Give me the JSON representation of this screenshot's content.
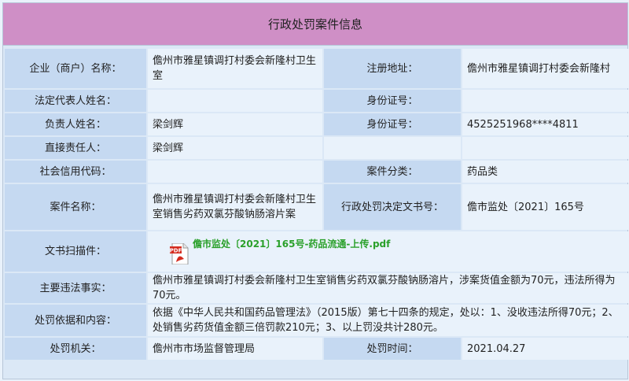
{
  "header": {
    "title": "行政处罚案件信息"
  },
  "rows": {
    "company_label": "企业（商户）名称：",
    "company_value": "儋州市雅星镇调打村委会新隆村卫生室",
    "reg_address_label": "注册地址：",
    "reg_address_value": "儋州市雅星镇调打村委会新隆村",
    "legal_rep_label": "法定代表人姓名：",
    "legal_rep_value": "",
    "id1_label": "身份证号：",
    "id1_value": "",
    "principal_label": "负责人姓名：",
    "principal_value": "梁剑辉",
    "id2_label": "身份证号：",
    "id2_value": "4525251968****4811",
    "direct_label": "直接责任人：",
    "direct_value": "梁剑辉",
    "credit_label": "社会信用代码：",
    "credit_value": "",
    "category_label": "案件分类：",
    "category_value": "药品类",
    "case_name_label": "案件名称：",
    "case_name_value": "儋州市雅星镇调打村委会新隆村卫生室销售劣药双氯芬酸钠肠溶片案",
    "decision_no_label": "行政处罚决定文书号：",
    "decision_no_value": "儋市监处〔2021〕165号",
    "scan_label": "文书扫描件：",
    "scan_file": "儋市监处〔2021〕165号-药品流通-上传.pdf",
    "facts_label": "主要违法事实：",
    "facts_value": "儋州市雅星镇调打村委会新隆村卫生室销售劣药双氯芬酸钠肠溶片，涉案货值金额为70元，违法所得为70元。",
    "basis_label": "处罚依据和内容：",
    "basis_value": "依据《中华人民共和国药品管理法》（2015版）第七十四条的规定，处以：1、没收违法所得70元；2、处销售劣药货值金额三倍罚款210元；3、以上罚没共计280元。",
    "authority_label": "处罚机关：",
    "authority_value": "儋州市市场监督管理局",
    "time_label": "处罚时间：",
    "time_value": "2021.04.27"
  },
  "icons": {
    "file": "pdf-icon"
  },
  "colors": {
    "title_bg": "#cf8fc6",
    "label_bg": "#c5d9f1",
    "value_bg": "#e9f2fb",
    "link": "#2aa02a"
  }
}
